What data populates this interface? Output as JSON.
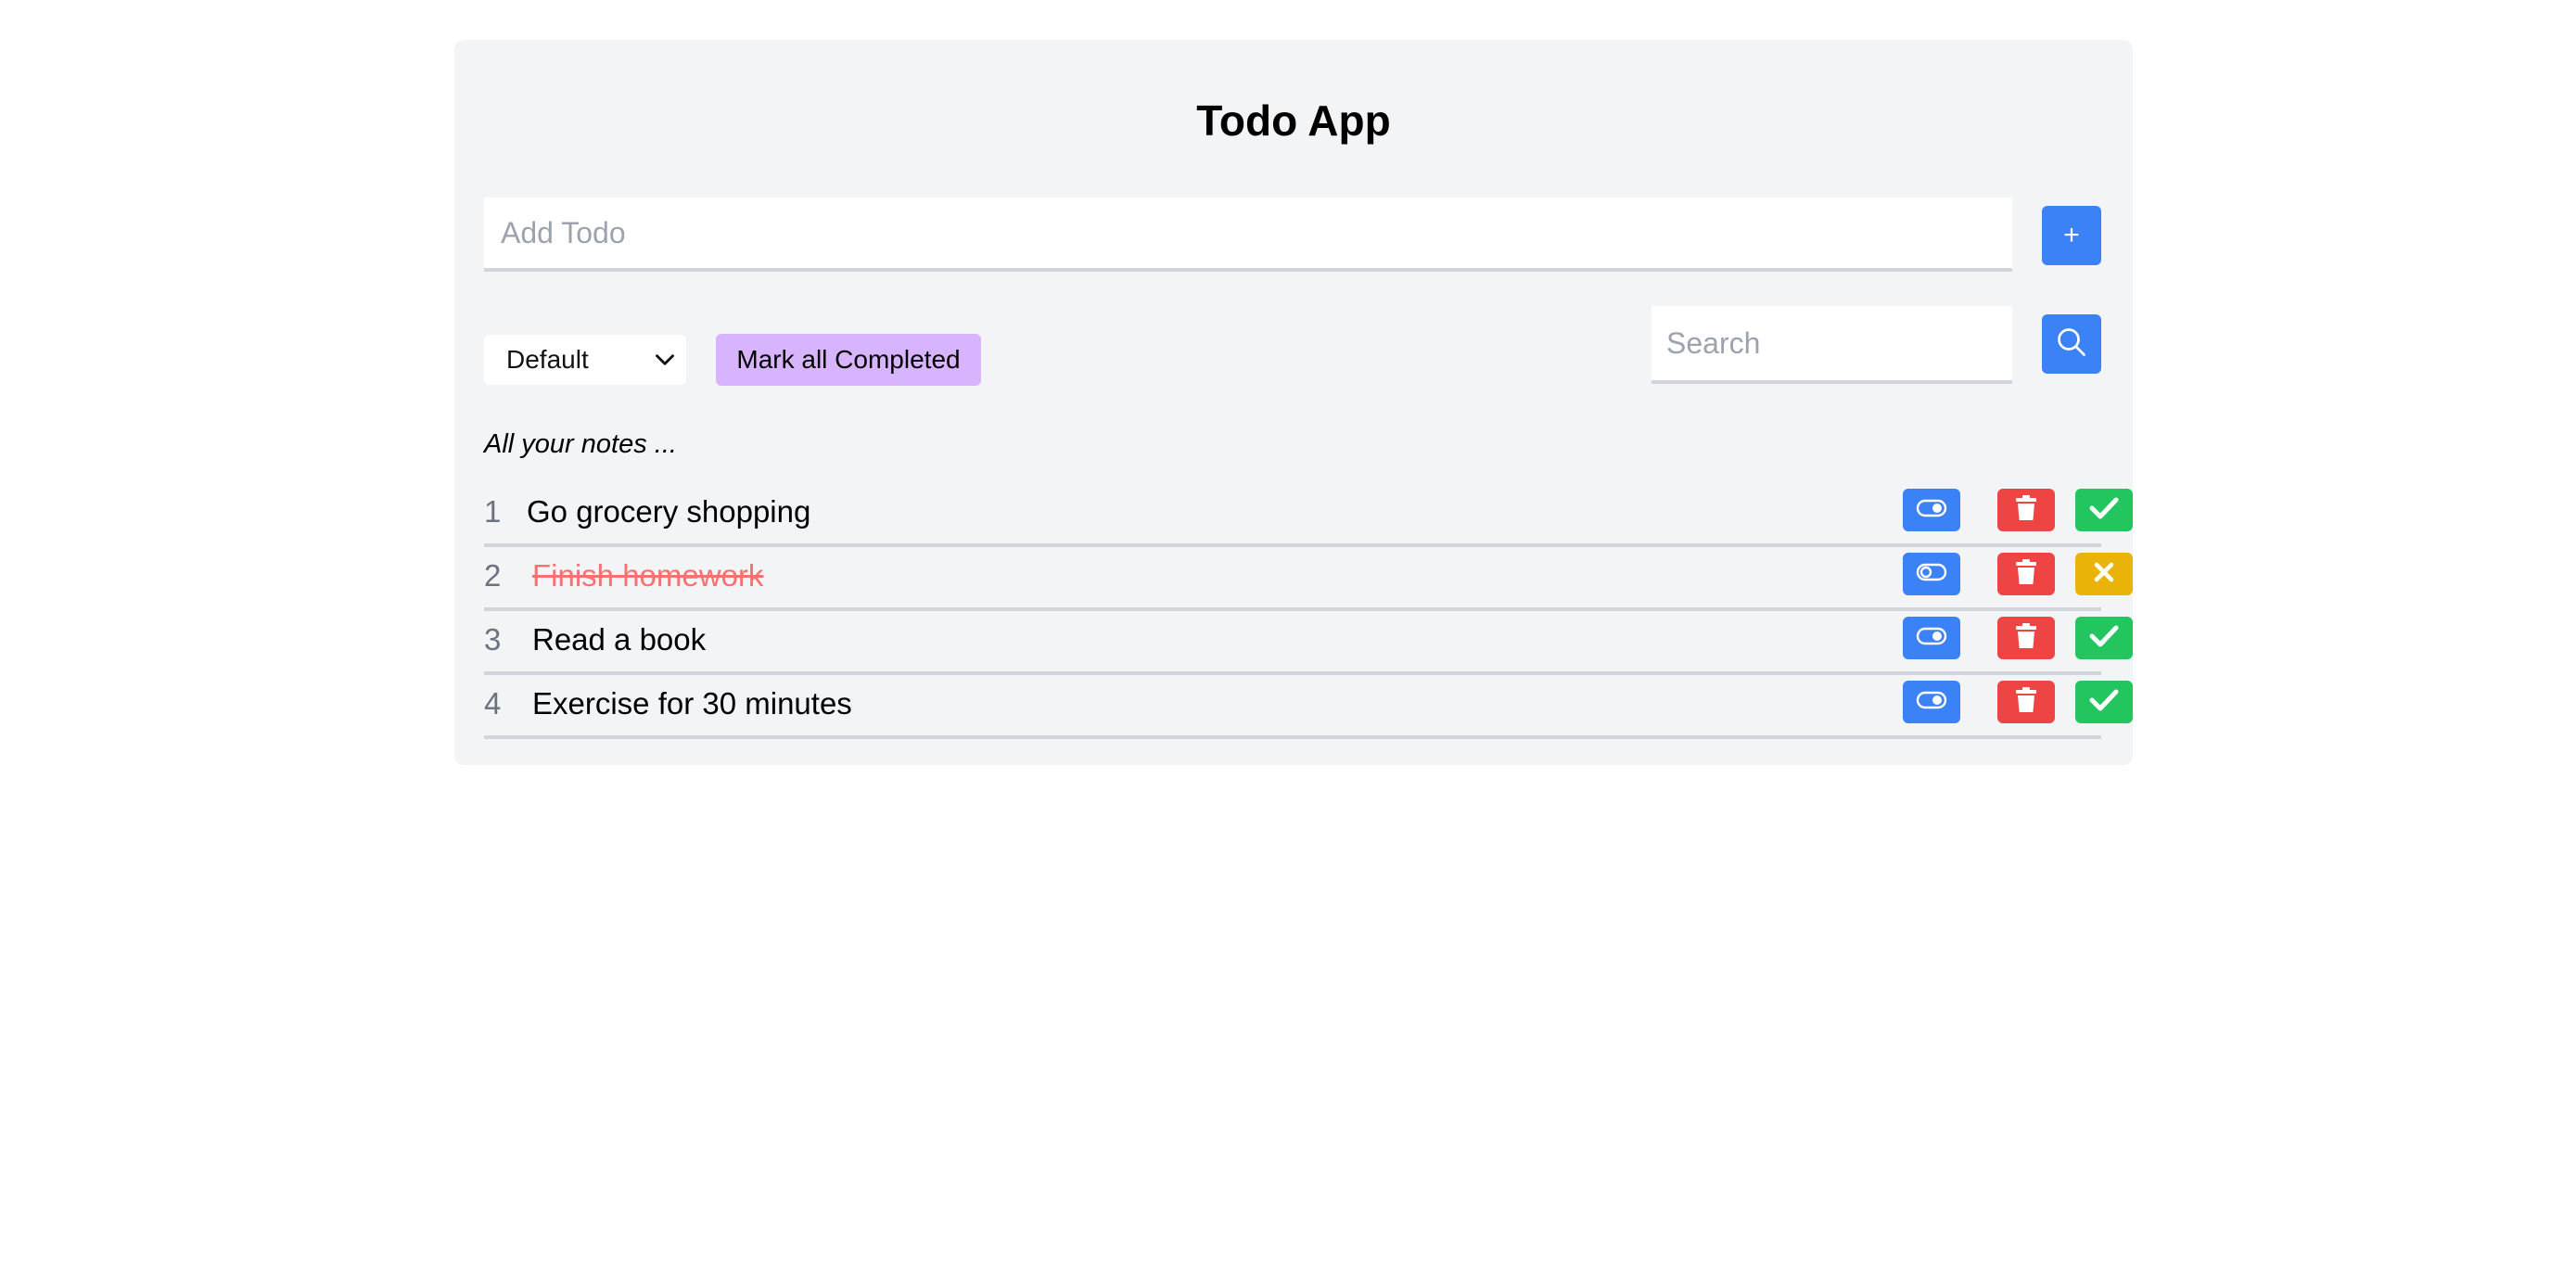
{
  "app": {
    "title": "Todo App"
  },
  "add": {
    "placeholder": "Add Todo",
    "button_label": "+"
  },
  "controls": {
    "sort_selected": "Default",
    "mark_all_label": "Mark all Completed",
    "search_placeholder": "Search"
  },
  "list": {
    "heading": "All your notes ...",
    "items": [
      {
        "number": "1",
        "text": "Go grocery shopping",
        "completed": false
      },
      {
        "number": "2",
        "text": "Finish homework",
        "completed": true
      },
      {
        "number": "3",
        "text": "Read a book",
        "completed": false
      },
      {
        "number": "4",
        "text": "Exercise for 30 minutes",
        "completed": false
      }
    ]
  },
  "icons": {
    "toggle": "toggle-icon",
    "delete": "trash-icon",
    "complete": "check-icon",
    "uncomplete": "x-icon",
    "search": "search-icon",
    "dropdown": "chevron-down-icon"
  },
  "colors": {
    "primary": "#3b82f6",
    "danger": "#ef4444",
    "success": "#22c55e",
    "warning": "#eab308",
    "accent": "#d8b4fe",
    "completed_text": "#f87171"
  }
}
